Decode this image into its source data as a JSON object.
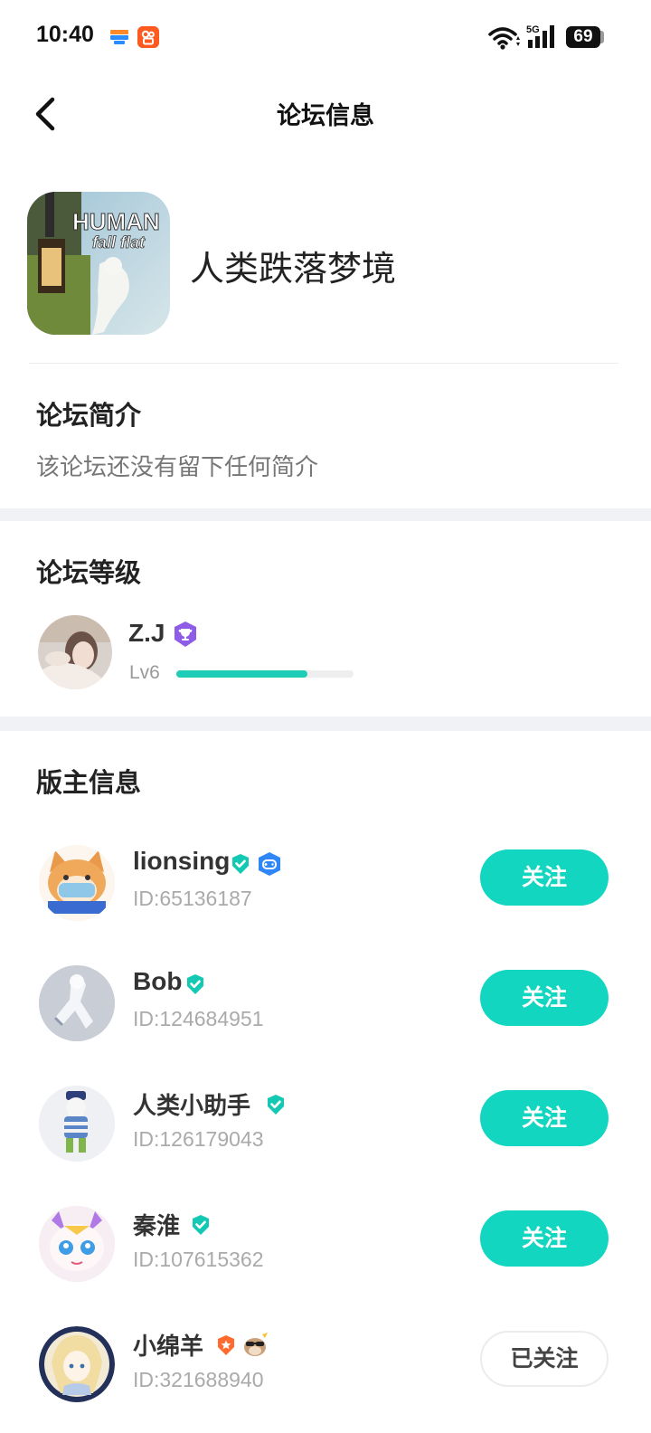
{
  "status_bar": {
    "time": "10:40",
    "battery": "69",
    "icons": [
      "wallet-app-icon",
      "kwai-app-icon",
      "wifi-icon",
      "5g-signal-icon",
      "battery-icon"
    ],
    "signal_label": "5G"
  },
  "nav": {
    "back_icon": "chevron-left-icon",
    "title": "论坛信息"
  },
  "forum": {
    "name": "人类跌落梦境",
    "cover_text_top": "HUMAN",
    "cover_text_bottom": "fall flat"
  },
  "intro": {
    "title": "论坛简介",
    "text": "该论坛还没有留下任何简介"
  },
  "level": {
    "title": "论坛等级",
    "user_name": "Z.J",
    "level_label": "Lv6",
    "progress": 0.74,
    "badge_icon": "trophy-icon"
  },
  "moderators": {
    "title": "版主信息",
    "items": [
      {
        "name": "lionsing",
        "id": "ID:65136187",
        "button": "关注",
        "badges": [
          "verified-icon",
          "game-controller-icon"
        ]
      },
      {
        "name": "Bob",
        "id": "ID:124684951",
        "button": "关注",
        "badges": [
          "verified-icon"
        ]
      },
      {
        "name": "人类小助手",
        "id": "ID:126179043",
        "button": "关注",
        "badges": [
          "verified-icon"
        ]
      },
      {
        "name": "秦淮",
        "id": "ID:107615362",
        "button": "关注",
        "badges": [
          "verified-icon"
        ]
      },
      {
        "name": "小绵羊",
        "id": "ID:321688940",
        "button": "已关注",
        "badges": [
          "orange-star-icon",
          "sunglasses-emoji-icon"
        ]
      }
    ]
  },
  "colors": {
    "accent": "#12d6c0",
    "progress": "#1fcdb6",
    "verified": "#14c9b3",
    "section_gap": "#f0f2f5",
    "trophy": "#8e5ce6"
  }
}
